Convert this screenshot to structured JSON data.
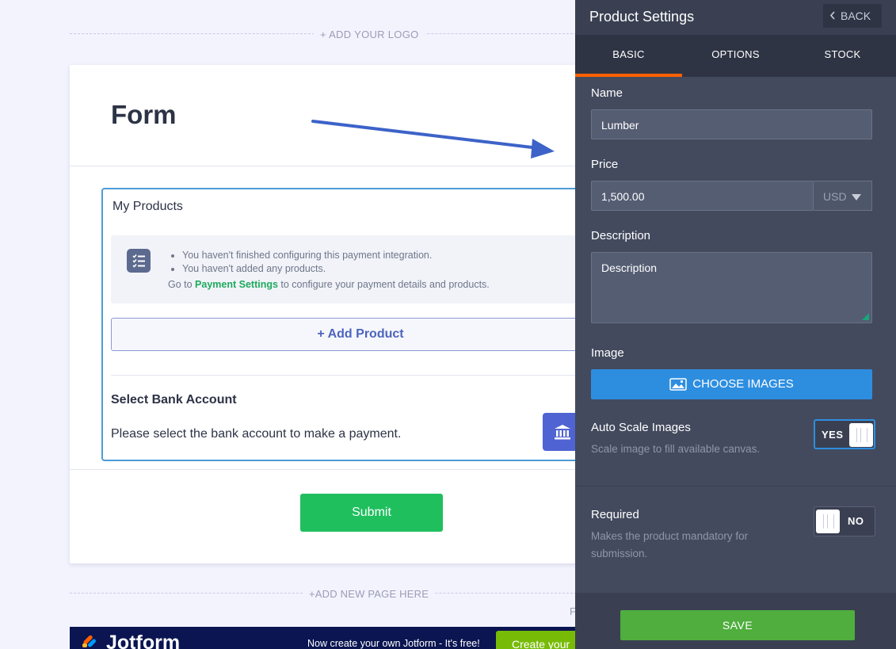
{
  "form": {
    "logo_placeholder": "+ ADD YOUR LOGO",
    "title": "Form",
    "products": {
      "label": "My Products",
      "warnings": [
        "You haven't finished configuring this payment integration.",
        "You haven't added any products."
      ],
      "goto_prefix": "Go to ",
      "goto_link": "Payment Settings",
      "goto_suffix": " to configure your payment details and products.",
      "add_product": "+ Add Product",
      "bank_title": "Select Bank Account",
      "bank_desc": "Please select the bank account to make a payment."
    },
    "submit_label": "Submit",
    "add_page": "+ADD NEW PAGE HERE",
    "stray_text": "F"
  },
  "banner": {
    "brand": "Jotform",
    "tagline": "Now create your own Jotform - It's free!",
    "cta": "Create your"
  },
  "panel": {
    "title": "Product Settings",
    "back_label": "BACK",
    "tabs": [
      "BASIC",
      "OPTIONS",
      "STOCK"
    ],
    "active_tab": "BASIC",
    "name_label": "Name",
    "name_value": "Lumber",
    "price_label": "Price",
    "price_value": "1,500.00",
    "currency": "USD",
    "description_label": "Description",
    "description_value": "Description",
    "image_label": "Image",
    "choose_images": "CHOOSE IMAGES",
    "auto_scale": {
      "title": "Auto Scale Images",
      "subtitle": "Scale image to fill available canvas.",
      "state": "YES"
    },
    "required": {
      "title": "Required",
      "subtitle": "Makes the product mandatory for submission.",
      "state": "NO"
    },
    "save_label": "SAVE"
  },
  "colors": {
    "accent_tab": "#ff6100",
    "choose_button": "#2d8ee0",
    "save_button": "#4fae3d",
    "submit_button": "#1fbf5e",
    "payment_link": "#1eaa5c"
  }
}
